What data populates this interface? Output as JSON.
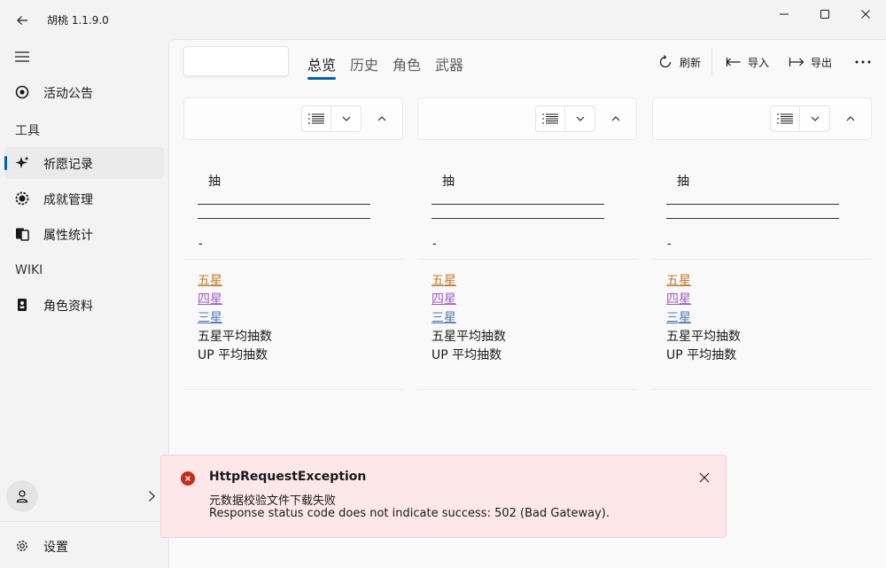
{
  "app": {
    "title": "胡桃 1.1.9.0"
  },
  "sidebar": {
    "items": [
      {
        "label": "活动公告",
        "icon": "announcement-icon"
      },
      {
        "label": "祈愿记录",
        "icon": "sparkle-icon",
        "selected": true
      },
      {
        "label": "成就管理",
        "icon": "achievement-icon"
      },
      {
        "label": "属性统计",
        "icon": "stats-icon"
      },
      {
        "label": "角色资料",
        "icon": "character-card-icon"
      }
    ],
    "headers": {
      "tools": "工具",
      "wiki": "WIKI"
    },
    "settings_label": "设置"
  },
  "toolbar": {
    "tabs": [
      "总览",
      "历史",
      "角色",
      "武器"
    ],
    "active_tab": "总览",
    "refresh_label": "刷新",
    "import_label": "导入",
    "export_label": "导出"
  },
  "columns": [
    {
      "pull_label": "抽",
      "dash": "-",
      "stats": {
        "five": "五星",
        "four": "四星",
        "three": "三星",
        "avg_five": "五星平均抽数",
        "avg_up": "UP 平均抽数"
      }
    },
    {
      "pull_label": "抽",
      "dash": "-",
      "stats": {
        "five": "五星",
        "four": "四星",
        "three": "三星",
        "avg_five": "五星平均抽数",
        "avg_up": "UP 平均抽数"
      }
    },
    {
      "pull_label": "抽",
      "dash": "-",
      "stats": {
        "five": "五星",
        "four": "四星",
        "three": "三星",
        "avg_five": "五星平均抽数",
        "avg_up": "UP 平均抽数"
      }
    }
  ],
  "infobar": {
    "title": "HttpRequestException",
    "message": "元数据校验文件下载失败",
    "detail": "Response status code does not indicate success: 502 (Bad Gateway).",
    "severity_color": "#c42b1c"
  },
  "colors": {
    "accent": "#005fb8",
    "five_star": "#c37a2c",
    "four_star": "#a35bc4",
    "three_star": "#4a78b5"
  }
}
